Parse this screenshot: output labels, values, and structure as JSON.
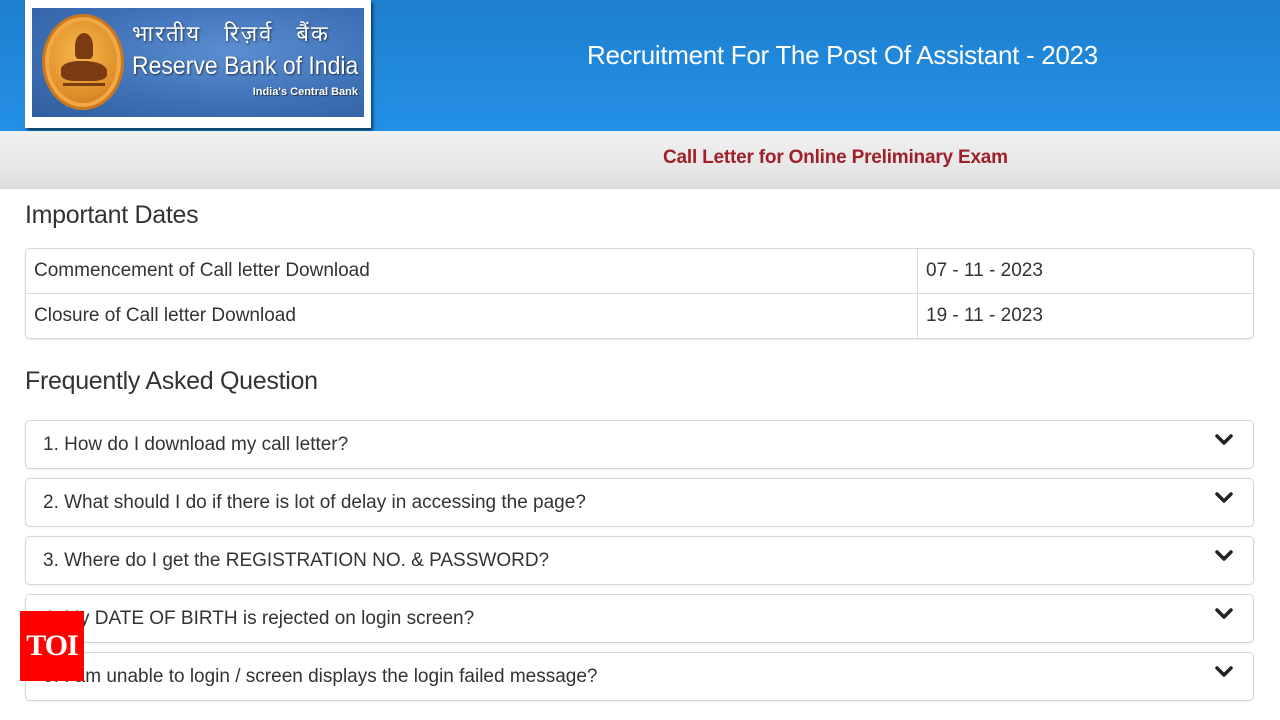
{
  "header": {
    "logo": {
      "hindi_name": "भारतीय रिज़र्व बैंक",
      "english_name": "Reserve Bank of India",
      "tagline": "India's Central Bank",
      "emblem_icon": "rbi-emblem-icon"
    },
    "title": "Recruitment For The Post Of Assistant - 2023"
  },
  "subheader": {
    "title": "Call Letter for Online Preliminary Exam"
  },
  "important_dates": {
    "heading": "Important Dates",
    "rows": [
      {
        "label": "Commencement of Call letter Download",
        "value": "07 - 11 - 2023"
      },
      {
        "label": "Closure of Call letter Download",
        "value": "19 - 11 - 2023"
      }
    ]
  },
  "faq": {
    "heading": "Frequently Asked Question",
    "expand_icon": "chevron-down-icon",
    "items": [
      {
        "question": "1. How do I download my call letter?"
      },
      {
        "question": "2. What should I do if there is lot of delay in accessing the page?"
      },
      {
        "question": "3. Where do I get the REGISTRATION NO. & PASSWORD?"
      },
      {
        "question": "4. My DATE OF BIRTH is rejected on login screen?"
      },
      {
        "question": "5. I am unable to login / screen displays the login failed message?"
      }
    ]
  },
  "watermark": {
    "text": "TOI"
  },
  "colors": {
    "header_blue": "#2290e6",
    "subheader_title": "#a0202a",
    "watermark_red": "#ff0000"
  }
}
